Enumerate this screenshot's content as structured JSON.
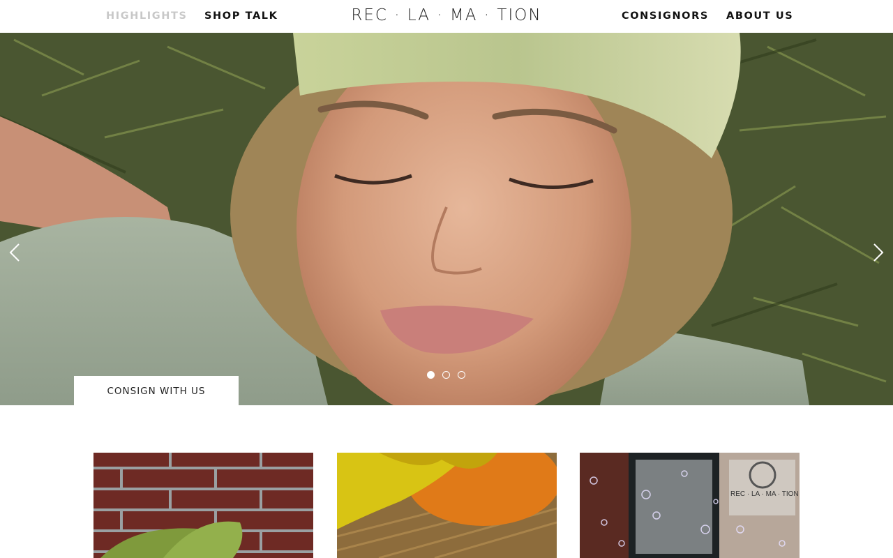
{
  "header": {
    "brand": "REC · LA · MA · TION",
    "nav_left": [
      {
        "label": "HIGHLIGHTS",
        "active": true
      },
      {
        "label": "SHOP TALK",
        "active": false
      }
    ],
    "nav_right": [
      {
        "label": "CONSIGNORS"
      },
      {
        "label": "ABOUT US"
      }
    ]
  },
  "hero": {
    "cta_label": "CONSIGN WITH US",
    "slide_count": 3,
    "active_slide": 1,
    "prev_icon": "chevron-left-icon",
    "next_icon": "chevron-right-icon"
  },
  "cards": [
    {
      "name": "brick-wall-plant-photo"
    },
    {
      "name": "sunflower-orange-photo"
    },
    {
      "name": "storefront-bubbles-photo",
      "sign_text": "REC · LA · MA · TION"
    }
  ],
  "colors": {
    "nav_active": "#c8c8c8",
    "nav_text": "#111111",
    "cta_bg": "#ffffff"
  }
}
